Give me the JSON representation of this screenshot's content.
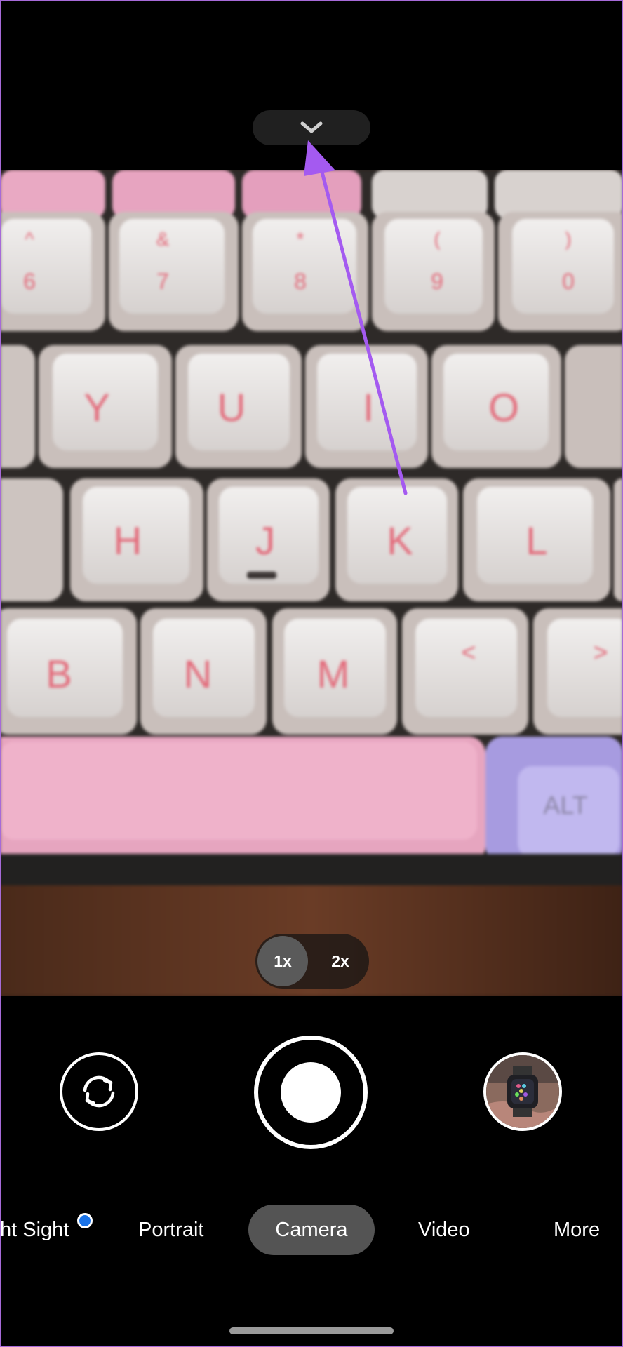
{
  "icons": {
    "settings_toggle": "chevron-down-icon",
    "flip": "switch-camera-icon",
    "shutter": "shutter-icon",
    "gallery": "gallery-thumbnail"
  },
  "colors": {
    "background": "#000000",
    "selected_mode_bg": "#545454",
    "new_badge": "#1a73e8",
    "annotation_arrow": "#a45af0"
  },
  "zoom": {
    "options": [
      "1x",
      "2x"
    ],
    "selected": "1x"
  },
  "modes": {
    "items": [
      "ht Sight",
      "Portrait",
      "Camera",
      "Video",
      "More"
    ],
    "selected": "Camera"
  },
  "viewfinder": {
    "key_legends": {
      "row1": [
        "^",
        "&",
        "*",
        "(",
        ")"
      ],
      "row1_bottom": [
        "6",
        "7",
        "8",
        "9",
        "0"
      ],
      "row2": [
        "Y",
        "U",
        "I",
        "O"
      ],
      "row3": [
        "H",
        "J",
        "K",
        "L"
      ],
      "row4": [
        "B",
        "N",
        "M",
        "<",
        ">"
      ],
      "alt": "ALT"
    }
  }
}
